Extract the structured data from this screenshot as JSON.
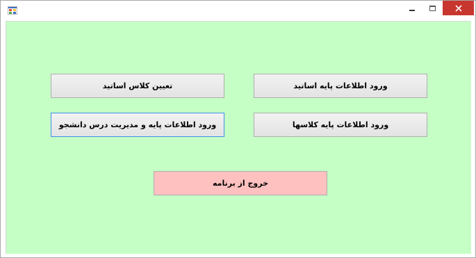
{
  "window": {
    "close_glyph": "✕"
  },
  "buttons": {
    "professor_base_info": "ورود اطلاعات پایه اساتید",
    "assign_professor_class": "تعیین کلاس اساتید",
    "class_base_info": "ورود اطلاعات پایه کلاسها",
    "student_course_management": "ورود اطلاعات پایه و مدیریت درس دانشجو",
    "exit": "خروج از برنامه"
  },
  "colors": {
    "client_background": "#c6ffc6",
    "exit_button": "#ffc0c0",
    "close_button": "#c7372f",
    "focus_border": "#3c8ee6"
  }
}
